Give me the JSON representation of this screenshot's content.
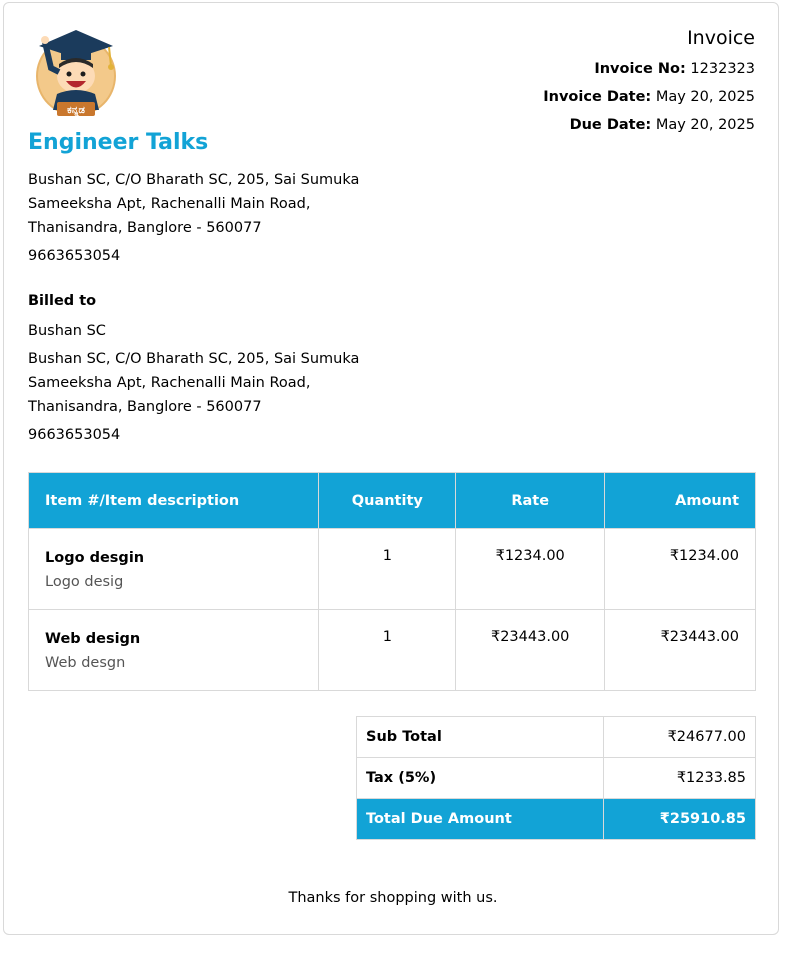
{
  "company": {
    "name": "Engineer Talks",
    "address_lines": [
      "Bushan SC, C/O Bharath SC, 205, Sai Sumuka",
      "Sameeksha Apt, Rachenalli Main Road,",
      "Thanisandra, Banglore - 560077"
    ],
    "phone": "9663653054",
    "logo_icon": "graduate-mascot-logo-icon",
    "logo_text": "ಕನ್ನಡ"
  },
  "invoice": {
    "title": "Invoice",
    "number_label": "Invoice No:",
    "number": "1232323",
    "date_label": "Invoice Date:",
    "date": "May 20, 2025",
    "due_label": "Due Date:",
    "due": "May 20, 2025"
  },
  "billed_to": {
    "label": "Billed to",
    "name": "Bushan SC",
    "address_lines": [
      "Bushan SC, C/O Bharath SC, 205, Sai Sumuka",
      "Sameeksha Apt, Rachenalli Main Road,",
      "Thanisandra, Banglore - 560077"
    ],
    "phone": "9663653054"
  },
  "items_table": {
    "headers": [
      "Item #/Item description",
      "Quantity",
      "Rate",
      "Amount"
    ],
    "rows": [
      {
        "name": "Logo desgin",
        "desc": "Logo desig",
        "qty": "1",
        "rate": "₹1234.00",
        "amount": "₹1234.00"
      },
      {
        "name": "Web design",
        "desc": "Web desgn",
        "qty": "1",
        "rate": "₹23443.00",
        "amount": "₹23443.00"
      }
    ]
  },
  "totals": {
    "subtotal_label": "Sub Total",
    "subtotal": "₹24677.00",
    "tax_label": "Tax (5%)",
    "tax": "₹1233.85",
    "total_label": "Total Due Amount",
    "total": "₹25910.85"
  },
  "footer": {
    "thanks": "Thanks for shopping with us."
  },
  "colors": {
    "accent": "#12a3d6",
    "border": "#d9d9d9",
    "muted_text": "#555555"
  }
}
